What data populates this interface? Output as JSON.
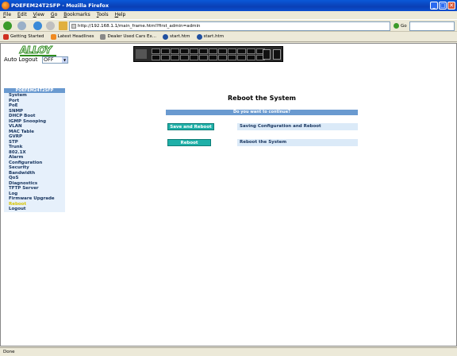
{
  "window": {
    "title": "POEFEM24T2SFP - Mozilla Firefox",
    "min": "_",
    "max": "□",
    "close": "✕"
  },
  "menu": [
    "File",
    "Edit",
    "View",
    "Go",
    "Bookmarks",
    "Tools",
    "Help"
  ],
  "address": {
    "url": "http://192.168.1.1/main_frame.html?first_admin=admin",
    "go_label": "Go"
  },
  "bookmarks": [
    {
      "label": "Getting Started",
      "color": "#d03020"
    },
    {
      "label": "Latest Headlines",
      "color": "#f08a20"
    },
    {
      "label": "Dealer Used Cars Ex...",
      "color": "#888888"
    },
    {
      "label": "start.htm",
      "color": "#2050a0"
    },
    {
      "label": "start.htm",
      "color": "#2050a0"
    }
  ],
  "header": {
    "logo": "ALLOY",
    "auto_logout_label": "Auto Logout",
    "auto_logout_value": "OFF"
  },
  "sidebar": {
    "title": "POEFEM24T2SFP",
    "items": [
      "System",
      "Port",
      "PoE",
      "SNMP",
      "DHCP Boot",
      "IGMP Snooping",
      "VLAN",
      "MAC Table",
      "GVRP",
      "STP",
      "Trunk",
      "802.1X",
      "Alarm",
      "Configuration",
      "Security",
      "Bandwidth",
      "QoS",
      "Diagnostics",
      "TFTP Server",
      "Log",
      "Firmware Upgrade",
      "Reboot",
      "Logout"
    ],
    "active": "Reboot"
  },
  "main": {
    "title": "Reboot the System",
    "confirm_text": "Do you want to continue?",
    "save_reboot_button": "Save and Reboot",
    "save_reboot_desc": "Saving Configuration and Reboot",
    "reboot_button": "Reboot",
    "reboot_desc": "Reboot the System"
  },
  "status": "Done",
  "colors": {
    "header_blue": "#6a9ad0",
    "button_teal": "#1fb0a8",
    "active_item": "#d6c300"
  }
}
